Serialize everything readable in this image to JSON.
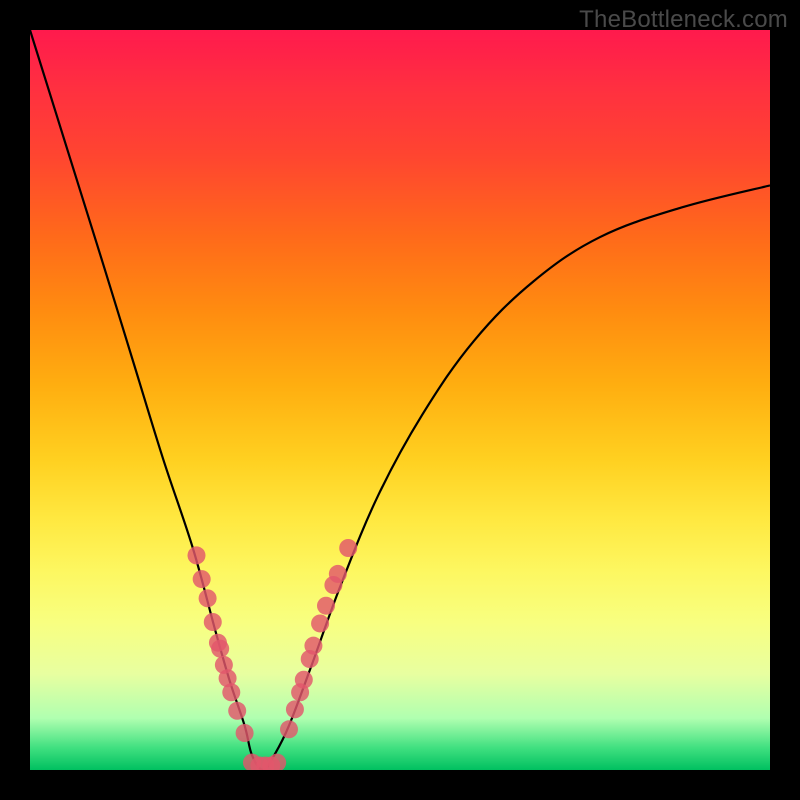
{
  "watermark": "TheBottleneck.com",
  "chart_data": {
    "type": "line",
    "title": "",
    "xlabel": "",
    "ylabel": "",
    "xlim": [
      0,
      1
    ],
    "ylim": [
      0,
      1
    ],
    "series": [
      {
        "name": "bottleneck-curve",
        "x": [
          0.0,
          0.05,
          0.1,
          0.14,
          0.18,
          0.22,
          0.25,
          0.27,
          0.29,
          0.3,
          0.315,
          0.33,
          0.35,
          0.38,
          0.42,
          0.47,
          0.53,
          0.6,
          0.68,
          0.77,
          0.88,
          1.0
        ],
        "y": [
          1.0,
          0.84,
          0.68,
          0.55,
          0.42,
          0.3,
          0.19,
          0.12,
          0.06,
          0.02,
          0.0,
          0.02,
          0.06,
          0.14,
          0.25,
          0.37,
          0.48,
          0.58,
          0.66,
          0.72,
          0.76,
          0.79
        ],
        "color": "#000000"
      }
    ],
    "scatter": [
      {
        "name": "left-cluster",
        "color": "#e2576b",
        "points": [
          {
            "x": 0.225,
            "y": 0.29
          },
          {
            "x": 0.232,
            "y": 0.258
          },
          {
            "x": 0.24,
            "y": 0.232
          },
          {
            "x": 0.247,
            "y": 0.2
          },
          {
            "x": 0.254,
            "y": 0.172
          },
          {
            "x": 0.257,
            "y": 0.164
          },
          {
            "x": 0.262,
            "y": 0.142
          },
          {
            "x": 0.267,
            "y": 0.124
          },
          {
            "x": 0.272,
            "y": 0.105
          },
          {
            "x": 0.28,
            "y": 0.08
          },
          {
            "x": 0.29,
            "y": 0.05
          }
        ]
      },
      {
        "name": "bottom-cluster",
        "color": "#e2576b",
        "points": [
          {
            "x": 0.3,
            "y": 0.01
          },
          {
            "x": 0.31,
            "y": 0.006
          },
          {
            "x": 0.318,
            "y": 0.006
          },
          {
            "x": 0.326,
            "y": 0.006
          },
          {
            "x": 0.334,
            "y": 0.01
          }
        ]
      },
      {
        "name": "right-cluster",
        "color": "#e2576b",
        "points": [
          {
            "x": 0.35,
            "y": 0.055
          },
          {
            "x": 0.358,
            "y": 0.082
          },
          {
            "x": 0.365,
            "y": 0.105
          },
          {
            "x": 0.37,
            "y": 0.122
          },
          {
            "x": 0.378,
            "y": 0.15
          },
          {
            "x": 0.383,
            "y": 0.168
          },
          {
            "x": 0.392,
            "y": 0.198
          },
          {
            "x": 0.4,
            "y": 0.222
          },
          {
            "x": 0.41,
            "y": 0.25
          },
          {
            "x": 0.416,
            "y": 0.265
          },
          {
            "x": 0.43,
            "y": 0.3
          }
        ]
      }
    ]
  }
}
